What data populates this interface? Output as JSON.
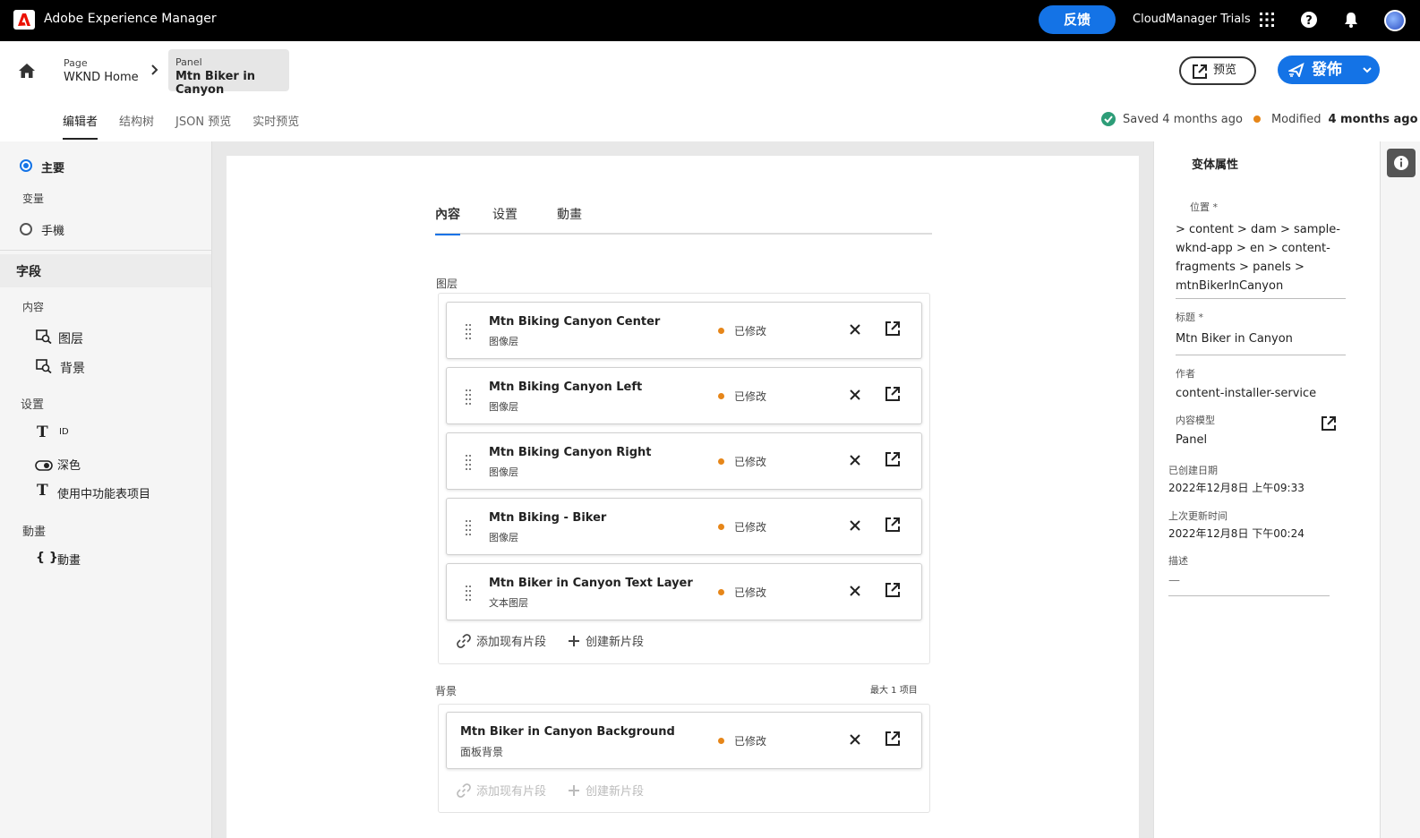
{
  "topbar": {
    "app_title": "Adobe Experience Manager",
    "feedback_label": "反馈",
    "org_name": "CloudManager Trials",
    "icons": [
      "apps-grid-icon",
      "help-icon",
      "bell-icon",
      "avatar"
    ]
  },
  "breadcrumb": {
    "items": [
      {
        "type": "Page",
        "title": "WKND Home"
      },
      {
        "type": "Panel",
        "title": "Mtn Biker in Canyon"
      }
    ]
  },
  "header": {
    "preview_label": "预览",
    "publish_label": "發佈",
    "tabs": [
      "编辑者",
      "结构树",
      "JSON 预览",
      "实时预览"
    ],
    "saved_text": "Saved 4 months ago",
    "modified_label": "Modified",
    "modified_time": "4 months ago"
  },
  "left": {
    "variant_main": "主要",
    "variants_heading": "变量",
    "variant_mobile": "手機",
    "fields_heading": "字段",
    "content_heading": "内容",
    "content_items": [
      "图层",
      "背景"
    ],
    "settings_heading": "设置",
    "settings_items": [
      "ID",
      "深色",
      "使用中功能表项目"
    ],
    "animation_heading": "動畫",
    "animation_items": [
      "動畫"
    ]
  },
  "form": {
    "tabs": [
      "內容",
      "设置",
      "動畫"
    ],
    "layers_label": "图层",
    "layers": [
      {
        "title": "Mtn Biking Canyon Center",
        "sub": "图像层",
        "status": "已修改"
      },
      {
        "title": "Mtn Biking Canyon Left",
        "sub": "图像层",
        "status": "已修改"
      },
      {
        "title": "Mtn Biking Canyon Right",
        "sub": "图像层",
        "status": "已修改"
      },
      {
        "title": "Mtn Biking - Biker",
        "sub": "图像层",
        "status": "已修改"
      },
      {
        "title": "Mtn Biker in Canyon Text Layer",
        "sub": "文本图层",
        "status": "已修改"
      }
    ],
    "add_existing": "添加现有片段",
    "create_new": "创建新片段",
    "background_label": "背景",
    "background_max": "最大 1 项目",
    "background": {
      "title": "Mtn Biker in Canyon Background",
      "sub": "面板背景",
      "status": "已修改"
    }
  },
  "right": {
    "title": "变体属性",
    "location_label": "位置 *",
    "location_value": "> content > dam > sample-wknd-app > en > content-fragments > panels > mtnBikerInCanyon",
    "title_label": "标题 *",
    "title_value": "Mtn Biker in Canyon",
    "author_label": "作者",
    "author_value": "content-installer-service",
    "model_label": "内容模型",
    "model_value": "Panel",
    "created_label": "已创建日期",
    "created_value": "2022年12月8日 上午09:33",
    "updated_label": "上次更新时间",
    "updated_value": "2022年12月8日 下午00:24",
    "desc_label": "描述",
    "desc_value": "—"
  }
}
